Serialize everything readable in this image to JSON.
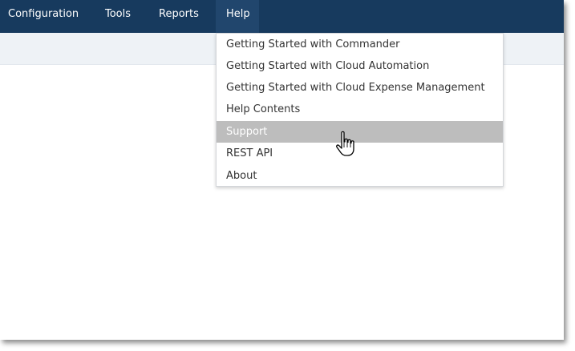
{
  "nav": {
    "items": [
      {
        "label": "Configuration"
      },
      {
        "label": "Tools"
      },
      {
        "label": "Reports"
      },
      {
        "label": "Help"
      }
    ]
  },
  "help_menu": {
    "items": [
      {
        "label": "Getting Started with Commander"
      },
      {
        "label": "Getting Started with Cloud Automation"
      },
      {
        "label": "Getting Started with Cloud Expense Management"
      },
      {
        "label": "Help Contents"
      },
      {
        "label": "Support"
      },
      {
        "label": "REST API"
      },
      {
        "label": "About"
      }
    ],
    "highlighted_item": "Support"
  },
  "colors": {
    "topbar": "#173a5e",
    "active_nav": "#21466d",
    "subbar": "#eef2f6",
    "highlight": "#bdbdbd"
  },
  "cursor": {
    "icon": "hand-pointer-icon"
  }
}
